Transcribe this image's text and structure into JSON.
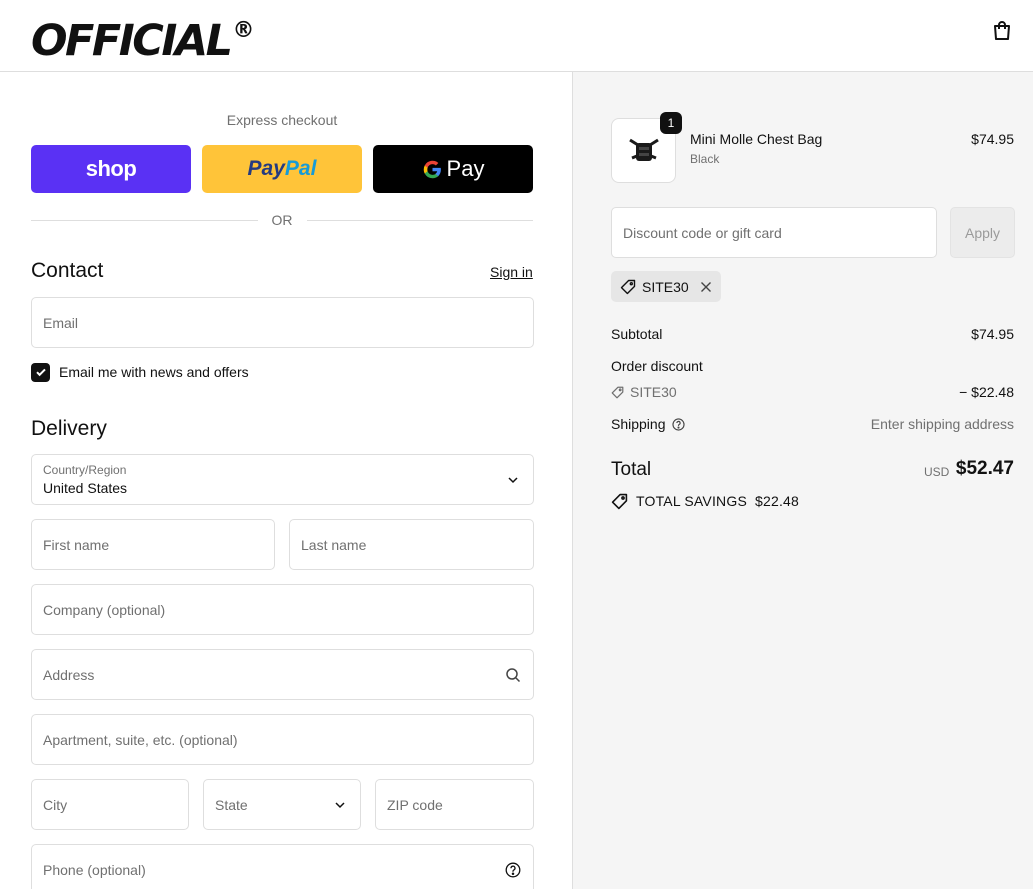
{
  "brand": {
    "logo_text": "OFFICIAL",
    "logo_mark": "®"
  },
  "icons": {
    "cart": "shopping-bag-icon",
    "tag": "tag-icon",
    "close": "close-icon",
    "search": "search-icon",
    "help": "help-circle-icon",
    "chevron": "chevron-down-icon",
    "check": "check-icon"
  },
  "colors": {
    "shop": "#5a31f4",
    "paypal": "#ffc439",
    "gpay": "#000000",
    "accent": "#111111"
  },
  "express": {
    "title": "Express checkout",
    "shop_label": "shop",
    "paypal_part1": "Pay",
    "paypal_part2": "Pal",
    "gpay_label": "Pay",
    "or_label": "OR"
  },
  "contact": {
    "title": "Contact",
    "sign_in": "Sign in",
    "email_placeholder": "Email",
    "newsletter_label": "Email me with news and offers",
    "newsletter_checked": true
  },
  "delivery": {
    "title": "Delivery",
    "country_label": "Country/Region",
    "country_value": "United States",
    "first_name_placeholder": "First name",
    "last_name_placeholder": "Last name",
    "company_placeholder": "Company (optional)",
    "address_placeholder": "Address",
    "apartment_placeholder": "Apartment, suite, etc. (optional)",
    "city_placeholder": "City",
    "state_placeholder": "State",
    "zip_placeholder": "ZIP code",
    "phone_placeholder": "Phone (optional)"
  },
  "summary": {
    "product": {
      "name": "Mini Molle Chest Bag",
      "variant": "Black",
      "price": "$74.95",
      "quantity": "1"
    },
    "discount_placeholder": "Discount code or gift card",
    "apply_label": "Apply",
    "applied_code": "SITE30",
    "subtotal_label": "Subtotal",
    "subtotal_value": "$74.95",
    "order_discount_label": "Order discount",
    "discount_code": "SITE30",
    "discount_value": "− $22.48",
    "shipping_label": "Shipping",
    "shipping_value": "Enter shipping address",
    "total_label": "Total",
    "currency": "USD",
    "total_value": "$52.47",
    "savings_label": "TOTAL SAVINGS",
    "savings_value": "$22.48"
  }
}
